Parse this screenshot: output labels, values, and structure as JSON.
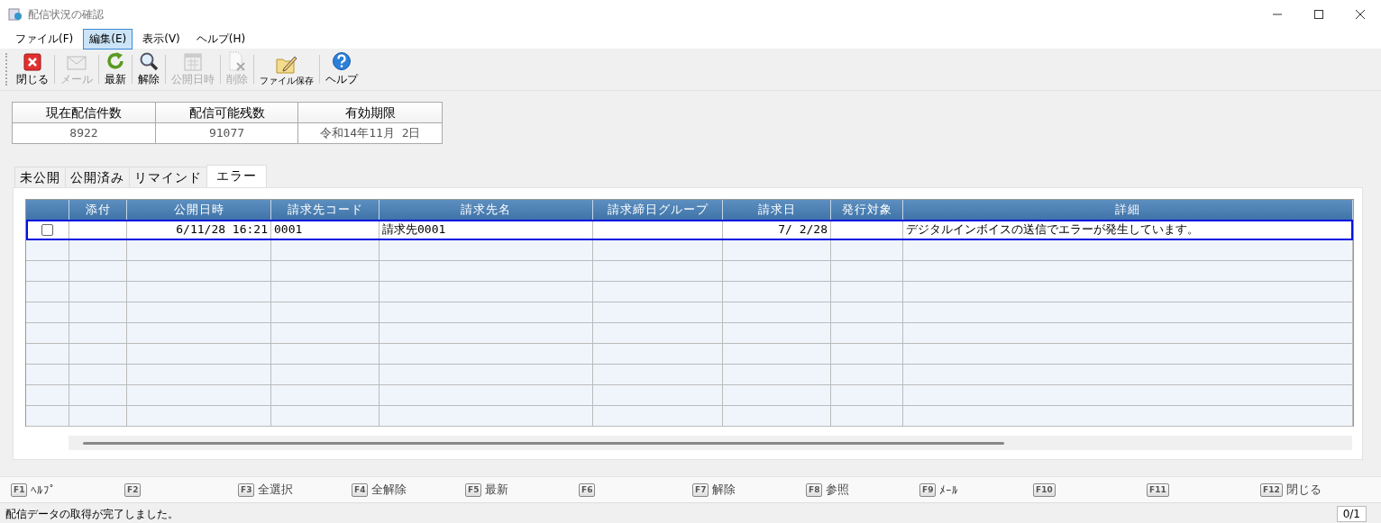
{
  "window": {
    "title": "配信状況の確認"
  },
  "menu": [
    {
      "label": "ファイル(F)",
      "selected": false
    },
    {
      "label": "編集(E)",
      "selected": true
    },
    {
      "label": "表示(V)",
      "selected": false
    },
    {
      "label": "ヘルプ(H)",
      "selected": false
    }
  ],
  "toolbar": [
    {
      "label": "閉じる",
      "kind": "close",
      "disabled": false
    },
    {
      "label": "メール",
      "kind": "mail",
      "disabled": true
    },
    {
      "label": "最新",
      "kind": "refresh",
      "disabled": false
    },
    {
      "label": "解除",
      "kind": "search",
      "disabled": false
    },
    {
      "label": "公開日時",
      "kind": "calendar",
      "disabled": true
    },
    {
      "label": "削除",
      "kind": "delete",
      "disabled": true
    },
    {
      "label": "ファイル保存",
      "kind": "save",
      "disabled": false
    },
    {
      "label": "ヘルプ",
      "kind": "help",
      "disabled": false
    }
  ],
  "summary": {
    "columns": [
      "現在配信件数",
      "配信可能残数",
      "有効期限"
    ],
    "values": [
      "8922",
      "91077",
      "令和14年11月 2日"
    ]
  },
  "tabs": [
    {
      "label": "未公開",
      "selected": false
    },
    {
      "label": "公開済み",
      "selected": false
    },
    {
      "label": "リマインド",
      "selected": false
    },
    {
      "label": "エラー",
      "selected": true
    }
  ],
  "table": {
    "columns": [
      "添付",
      "公開日時",
      "請求先コード",
      "請求先名",
      "請求締日グループ",
      "請求日",
      "発行対象",
      "詳細"
    ],
    "rows": [
      {
        "selected": true,
        "checked": false,
        "cells": [
          "",
          "6/11/28 16:21",
          "0001",
          "請求先0001",
          "",
          "7/ 2/28",
          "",
          "デジタルインボイスの送信でエラーが発生しています。"
        ]
      }
    ]
  },
  "function_keys": [
    {
      "key": "F1",
      "label": "ﾍﾙﾌﾟ"
    },
    {
      "key": "F2"
    },
    {
      "key": "F3",
      "label": "全選択"
    },
    {
      "key": "F4",
      "label": "全解除"
    },
    {
      "key": "F5",
      "label": "最新"
    },
    {
      "key": "F6"
    },
    {
      "key": "F7",
      "label": "解除"
    },
    {
      "key": "F8",
      "label": "参照"
    },
    {
      "key": "F9",
      "label": "ﾒｰﾙ"
    },
    {
      "key": "F10"
    },
    {
      "key": "F11"
    },
    {
      "key": "F12",
      "label": "閉じる"
    }
  ],
  "status_bar": {
    "message": "配信データの取得が完了しました。",
    "page": "0/1"
  }
}
